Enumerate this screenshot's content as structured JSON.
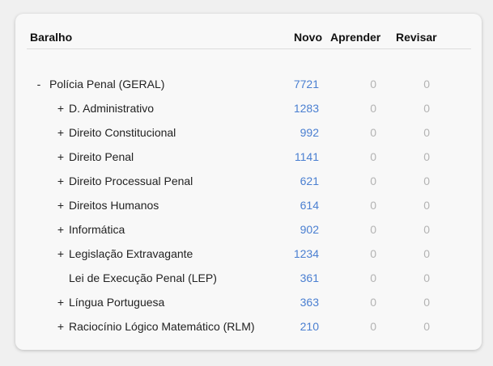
{
  "header": {
    "deck": "Baralho",
    "new": "Novo",
    "learn": "Aprender",
    "review": "Revisar"
  },
  "colors": {
    "new_count": "#4a7fd1",
    "zero_count": "#b3b3b3"
  },
  "decks": [
    {
      "expander": "-",
      "name": "Polícia Penal (GERAL)",
      "new": "7721",
      "learn": "0",
      "review": "0",
      "level": 0
    },
    {
      "expander": "+",
      "name": "D. Administrativo",
      "new": "1283",
      "learn": "0",
      "review": "0",
      "level": 1
    },
    {
      "expander": "+",
      "name": "Direito Constitucional",
      "new": "992",
      "learn": "0",
      "review": "0",
      "level": 1
    },
    {
      "expander": "+",
      "name": "Direito Penal",
      "new": "1141",
      "learn": "0",
      "review": "0",
      "level": 1
    },
    {
      "expander": "+",
      "name": "Direito Processual Penal",
      "new": "621",
      "learn": "0",
      "review": "0",
      "level": 1
    },
    {
      "expander": "+",
      "name": "Direitos Humanos",
      "new": "614",
      "learn": "0",
      "review": "0",
      "level": 1
    },
    {
      "expander": "+",
      "name": "Informática",
      "new": "902",
      "learn": "0",
      "review": "0",
      "level": 1
    },
    {
      "expander": "+",
      "name": "Legislação Extravagante",
      "new": "1234",
      "learn": "0",
      "review": "0",
      "level": 1
    },
    {
      "expander": "",
      "name": "Lei de Execução Penal (LEP)",
      "new": "361",
      "learn": "0",
      "review": "0",
      "level": 1
    },
    {
      "expander": "+",
      "name": "Língua Portuguesa",
      "new": "363",
      "learn": "0",
      "review": "0",
      "level": 1
    },
    {
      "expander": "+",
      "name": "Raciocínio Lógico Matemático (RLM)",
      "new": "210",
      "learn": "0",
      "review": "0",
      "level": 1
    }
  ]
}
